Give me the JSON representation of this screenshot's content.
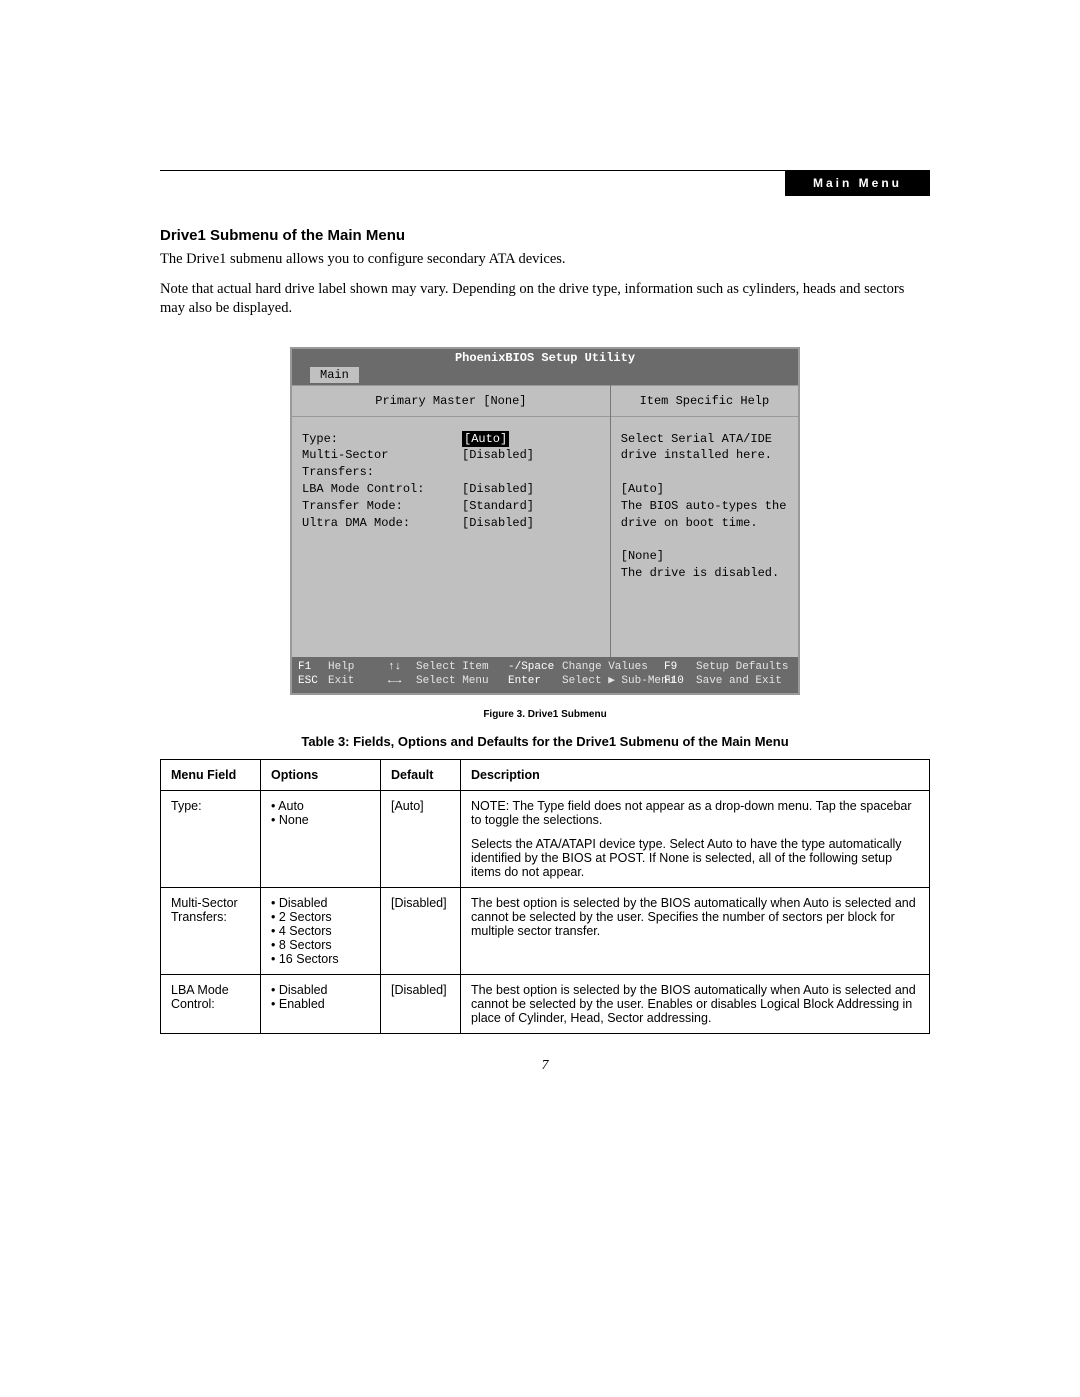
{
  "header": {
    "tag": "Main Menu"
  },
  "section": {
    "heading": "Drive1 Submenu of the Main Menu",
    "para1": "The Drive1 submenu allows you to configure secondary ATA devices.",
    "para2": "Note that actual hard drive label shown may vary. Depending on the drive type, information such as cylinders, heads and sectors may also be displayed."
  },
  "bios": {
    "title": "PhoenixBIOS Setup Utility",
    "tab": "Main",
    "panel_left_title": "Primary Master [None]",
    "panel_right_title": "Item Specific Help",
    "fields": [
      {
        "label": "Type:",
        "value": "[Auto]",
        "selected": true
      },
      {
        "label": "",
        "value": "",
        "selected": false
      },
      {
        "label": "Multi-Sector Transfers:",
        "value": "[Disabled]",
        "selected": false
      },
      {
        "label": "LBA Mode Control:",
        "value": "[Disabled]",
        "selected": false
      },
      {
        "label": "Transfer Mode:",
        "value": "[Standard]",
        "selected": false
      },
      {
        "label": "Ultra DMA Mode:",
        "value": "[Disabled]",
        "selected": false
      }
    ],
    "help": {
      "l1": "Select Serial ATA/IDE",
      "l2": "drive installed here.",
      "l3": "",
      "l4": "[Auto]",
      "l5": "The BIOS auto-types the",
      "l6": "drive on boot time.",
      "l7": "",
      "l8": "[None]",
      "l9": "The drive is disabled."
    },
    "footer": {
      "r1": {
        "k1": "F1",
        "a1": "Help",
        "arr1": "↑↓",
        "lbl1": "Select Item",
        "spc": "-/Space",
        "chg": "Change Values",
        "fk": "F9",
        "end": "Setup Defaults"
      },
      "r2": {
        "k1": "ESC",
        "a1": "Exit",
        "arr1": "←→",
        "lbl1": "Select Menu",
        "spc": "Enter",
        "chg": "Select ▶ Sub-Menu",
        "fk": "F10",
        "end": "Save and Exit"
      }
    }
  },
  "figure_caption": "Figure 3.   Drive1 Submenu",
  "table_caption": "Table 3: Fields, Options and Defaults for the Drive1 Submenu of the Main Menu",
  "table": {
    "headers": {
      "c1": "Menu Field",
      "c2": "Options",
      "c3": "Default",
      "c4": "Description"
    },
    "rows": [
      {
        "field": "Type:",
        "options": [
          "Auto",
          "None"
        ],
        "default": "[Auto]",
        "desc1": "NOTE: The Type field does not appear as a drop-down menu. Tap the spacebar to toggle the selections.",
        "desc2": "Selects the ATA/ATAPI device type. Select Auto to have the type automatically identified by the BIOS at POST. If None is selected, all of the following setup items do not appear."
      },
      {
        "field": "Multi-Sector Transfers:",
        "options": [
          "Disabled",
          "2 Sectors",
          "4 Sectors",
          "8 Sectors",
          "16 Sectors"
        ],
        "default": "[Disabled]",
        "desc1": "The best option is selected by the BIOS automatically when Auto is selected and cannot be selected by the user. Specifies the number of sectors per block for multiple sector transfer.",
        "desc2": ""
      },
      {
        "field": "LBA Mode Control:",
        "options": [
          "Disabled",
          "Enabled"
        ],
        "default": "[Disabled]",
        "desc1": "The best option is selected by the BIOS automatically when Auto is selected and cannot be selected by the user. Enables or disables Logical Block Addressing in place of Cylinder, Head, Sector addressing.",
        "desc2": ""
      }
    ]
  },
  "page_number": "7"
}
